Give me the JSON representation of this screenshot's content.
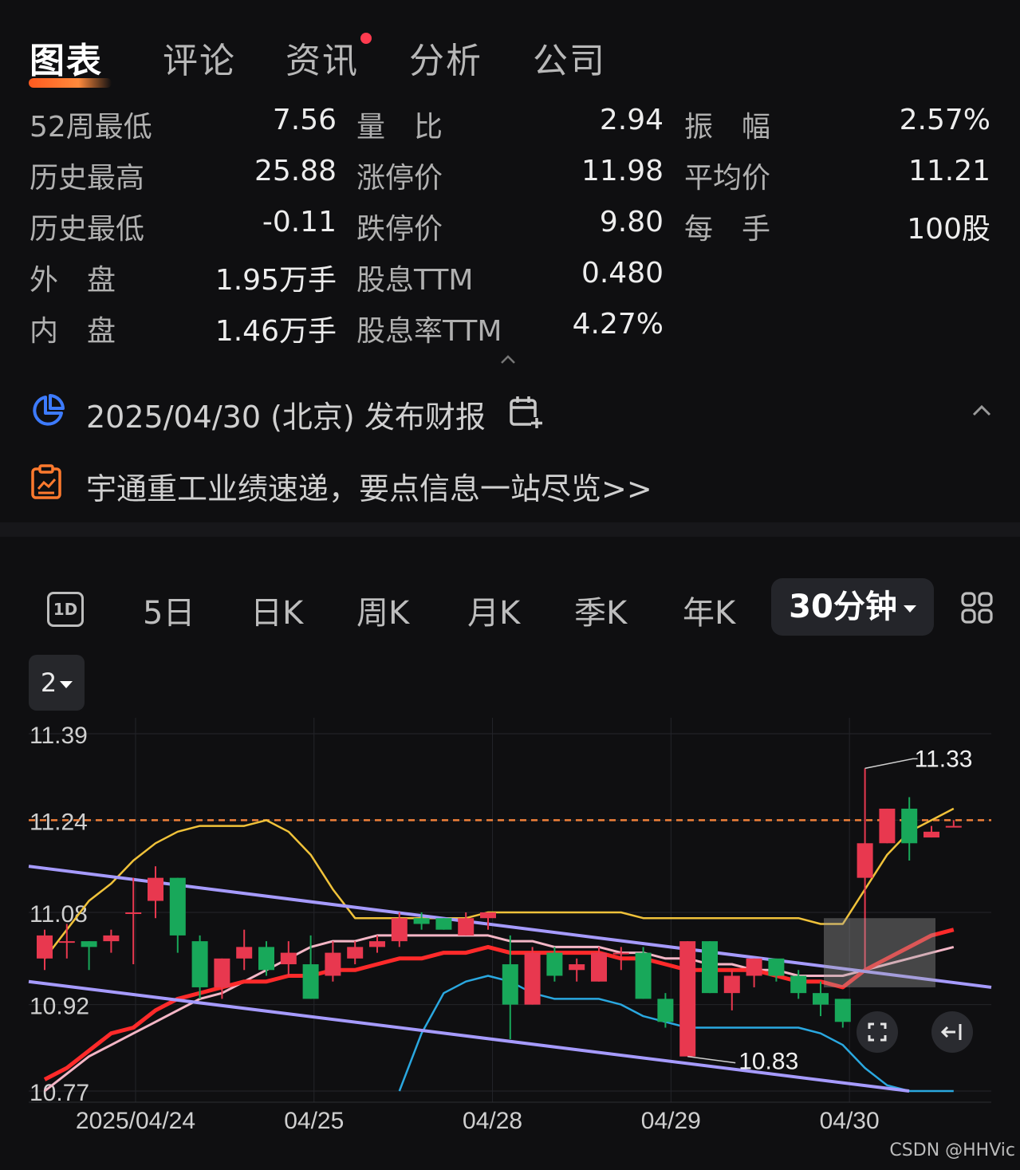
{
  "tabs": [
    {
      "label": "图表",
      "active": true
    },
    {
      "label": "评论"
    },
    {
      "label": "资讯",
      "has_dot": true
    },
    {
      "label": "分析"
    },
    {
      "label": "公司"
    }
  ],
  "stats": {
    "rows": [
      [
        {
          "label": "52周最低",
          "value": "7.56"
        },
        {
          "label": "量　比",
          "value": "2.94"
        },
        {
          "label": "振　幅",
          "value": "2.57%"
        }
      ],
      [
        {
          "label": "历史最高",
          "value": "25.88"
        },
        {
          "label": "涨停价",
          "value": "11.98"
        },
        {
          "label": "平均价",
          "value": "11.21"
        }
      ],
      [
        {
          "label": "历史最低",
          "value": "-0.11"
        },
        {
          "label": "跌停价",
          "value": "9.80"
        },
        {
          "label": "每　手",
          "value": "100股"
        }
      ],
      [
        {
          "label": "外　盘",
          "value": "1.95万手"
        },
        {
          "label": "股息TTM",
          "value": "0.480"
        }
      ],
      [
        {
          "label": "内　盘",
          "value": "1.46万手"
        },
        {
          "label": "股息率TTM",
          "value": "4.27%"
        }
      ]
    ]
  },
  "earnings": {
    "text": "2025/04/30 (北京) 发布财报",
    "icon": "pie-chart-icon"
  },
  "express": {
    "text": "宇通重工业绩速递，要点信息一站尽览>>",
    "icon": "report-icon"
  },
  "periods": {
    "items": [
      "5日",
      "日K",
      "周K",
      "月K",
      "季K",
      "年K"
    ],
    "icon_1d": "1D",
    "selected": "30分钟"
  },
  "indicator_count": "2",
  "chart_data": {
    "type": "candlestick",
    "y_ticks": [
      "11.39",
      "11.24",
      "11.08",
      "10.92",
      "10.77"
    ],
    "ylim": [
      10.77,
      11.39
    ],
    "x_ticks": [
      "2025/04/24",
      "04/25",
      "04/28",
      "04/29",
      "04/30"
    ],
    "ref_line": 11.24,
    "high_label": "11.33",
    "low_label": "10.83",
    "colors": {
      "up": "#e8384f",
      "down": "#18a85a",
      "ref": "#f0813a",
      "upper_band": "#f0c23a",
      "lower_band": "#2aa8e0",
      "ma_fast": "#ff2a2a",
      "ma_slow": "#f4b6c6",
      "channel": "#a69bff"
    },
    "candles": [
      [
        11.0,
        11.04,
        11.05,
        10.98
      ],
      [
        11.03,
        11.03,
        11.06,
        11.0
      ],
      [
        11.03,
        11.02,
        11.03,
        10.98
      ],
      [
        11.03,
        11.04,
        11.05,
        11.01
      ],
      [
        11.08,
        11.08,
        11.14,
        10.99
      ],
      [
        11.1,
        11.14,
        11.16,
        11.07
      ],
      [
        11.14,
        11.04,
        11.14,
        11.01
      ],
      [
        11.03,
        10.95,
        11.04,
        10.93
      ],
      [
        10.95,
        11.0,
        11.0,
        10.93
      ],
      [
        11.0,
        11.02,
        11.05,
        10.98
      ],
      [
        11.02,
        10.98,
        11.03,
        10.97
      ],
      [
        10.99,
        11.01,
        11.03,
        10.97
      ],
      [
        10.99,
        10.93,
        11.04,
        10.93
      ],
      [
        10.97,
        11.01,
        11.03,
        10.96
      ],
      [
        11.0,
        11.02,
        11.03,
        10.99
      ],
      [
        11.02,
        11.03,
        11.04,
        11.01
      ],
      [
        11.03,
        11.07,
        11.08,
        11.02
      ],
      [
        11.07,
        11.06,
        11.08,
        11.05
      ],
      [
        11.07,
        11.05,
        11.07,
        11.05
      ],
      [
        11.04,
        11.07,
        11.08,
        11.04
      ],
      [
        11.07,
        11.08,
        11.08,
        11.05
      ],
      [
        10.99,
        10.92,
        11.04,
        10.86
      ],
      [
        10.92,
        11.01,
        11.02,
        10.92
      ],
      [
        11.01,
        10.97,
        11.02,
        10.96
      ],
      [
        10.98,
        10.99,
        11.0,
        10.96
      ],
      [
        10.96,
        11.01,
        11.02,
        10.96
      ],
      [
        11.01,
        11.01,
        11.02,
        10.98
      ],
      [
        11.01,
        10.93,
        11.02,
        10.93
      ],
      [
        10.93,
        10.89,
        10.94,
        10.88
      ],
      [
        10.83,
        11.03,
        11.03,
        10.83
      ],
      [
        11.03,
        10.94,
        11.03,
        10.94
      ],
      [
        10.94,
        10.97,
        10.98,
        10.91
      ],
      [
        10.97,
        11.0,
        11.0,
        10.95
      ],
      [
        11.0,
        10.97,
        11.0,
        10.96
      ],
      [
        10.97,
        10.94,
        10.98,
        10.93
      ],
      [
        10.94,
        10.92,
        10.96,
        10.9
      ],
      [
        10.93,
        10.89,
        10.93,
        10.88
      ],
      [
        11.14,
        11.2,
        11.33,
        10.98
      ],
      [
        11.2,
        11.26,
        11.26,
        11.2
      ],
      [
        11.26,
        11.2,
        11.28,
        11.17
      ],
      [
        11.21,
        11.22,
        11.23,
        11.21
      ],
      [
        11.23,
        11.23,
        11.24,
        11.23
      ]
    ],
    "upper_band": [
      11.0,
      11.05,
      11.1,
      11.13,
      11.17,
      11.2,
      11.22,
      11.23,
      11.23,
      11.23,
      11.24,
      11.22,
      11.18,
      11.12,
      11.07,
      11.07,
      11.07,
      11.07,
      11.07,
      11.07,
      11.08,
      11.08,
      11.08,
      11.08,
      11.08,
      11.08,
      11.08,
      11.07,
      11.07,
      11.07,
      11.07,
      11.07,
      11.07,
      11.07,
      11.07,
      11.06,
      11.06,
      11.12,
      11.18,
      11.22,
      11.24,
      11.26
    ],
    "lower_band": [
      null,
      null,
      null,
      null,
      null,
      null,
      null,
      null,
      null,
      null,
      null,
      null,
      null,
      null,
      null,
      null,
      10.77,
      10.87,
      10.94,
      10.96,
      10.97,
      10.96,
      10.94,
      10.93,
      10.93,
      10.93,
      10.92,
      10.9,
      10.89,
      10.88,
      10.88,
      10.88,
      10.88,
      10.88,
      10.88,
      10.87,
      10.85,
      10.81,
      10.78,
      10.77,
      10.77,
      10.77
    ],
    "ma_fast": [
      10.79,
      10.81,
      10.84,
      10.87,
      10.88,
      10.91,
      10.93,
      10.94,
      10.95,
      10.96,
      10.96,
      10.97,
      10.97,
      10.98,
      10.98,
      10.99,
      11.0,
      11.0,
      11.01,
      11.01,
      11.02,
      11.01,
      11.01,
      11.01,
      11.01,
      11.01,
      11.0,
      11.0,
      10.99,
      10.98,
      10.98,
      10.98,
      10.98,
      10.97,
      10.96,
      10.96,
      10.95,
      10.98,
      11.0,
      11.02,
      11.04,
      11.05
    ],
    "ma_slow": [
      10.77,
      10.8,
      10.83,
      10.85,
      10.87,
      10.89,
      10.91,
      10.93,
      10.94,
      10.96,
      10.98,
      11.0,
      11.02,
      11.03,
      11.03,
      11.04,
      11.04,
      11.04,
      11.04,
      11.04,
      11.04,
      11.03,
      11.03,
      11.02,
      11.02,
      11.02,
      11.01,
      11.01,
      11.0,
      11.0,
      10.99,
      10.99,
      10.98,
      10.98,
      10.97,
      10.97,
      10.97,
      10.98,
      10.99,
      11.0,
      11.01,
      11.02
    ]
  },
  "chart_controls": {
    "fullscreen_icon": "expand-icon",
    "collapse_icon": "arrow-left-bar-icon"
  },
  "watermark": "CSDN @HHVic"
}
